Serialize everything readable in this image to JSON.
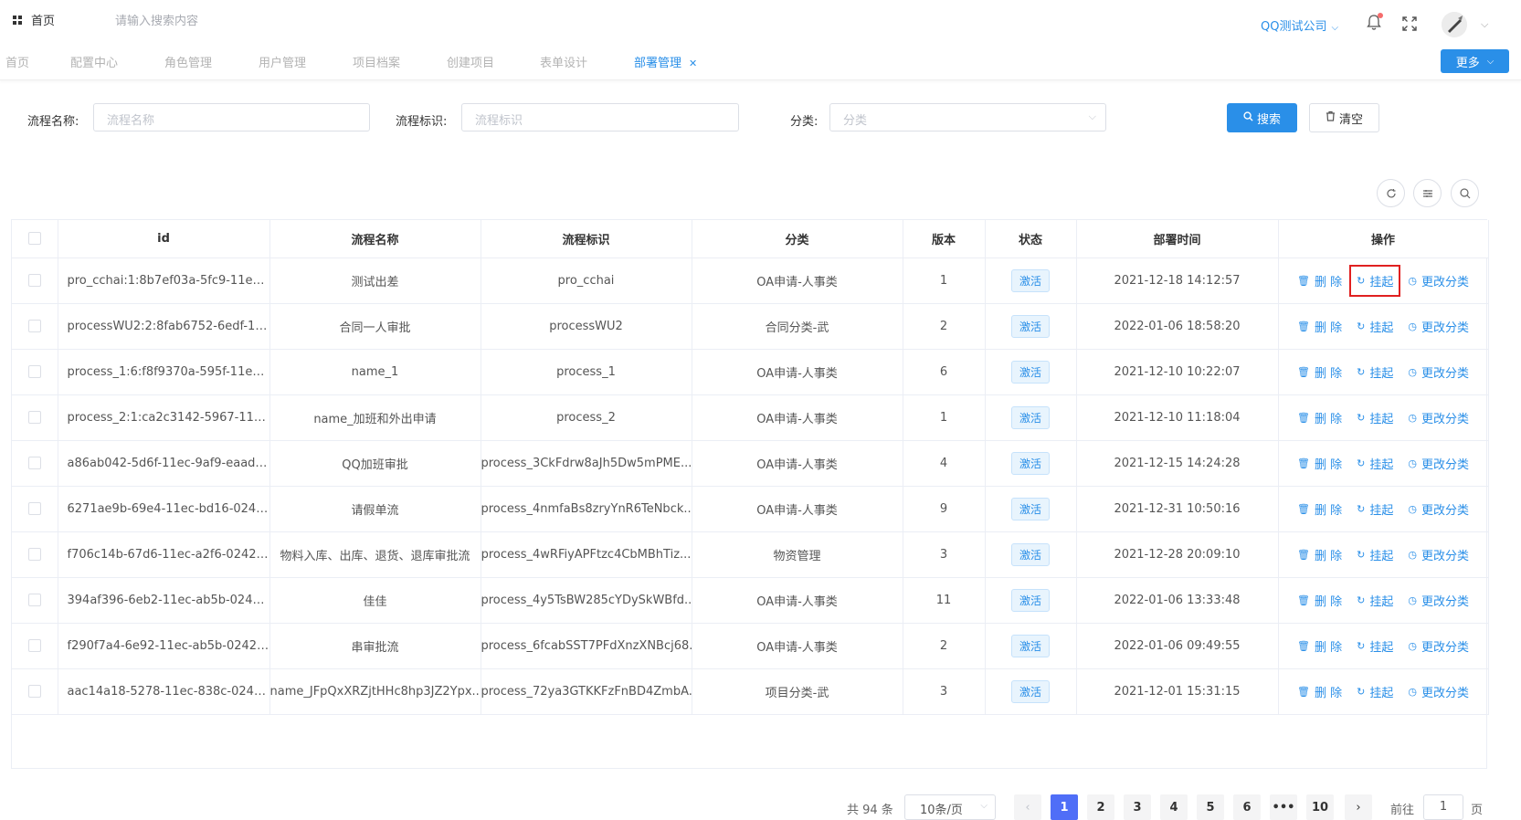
{
  "topbar": {
    "home_label": "首页",
    "search_placeholder": "请输入搜索内容",
    "company": "QQ测试公司"
  },
  "tabs": [
    {
      "label": "首页"
    },
    {
      "label": "配置中心"
    },
    {
      "label": "角色管理"
    },
    {
      "label": "用户管理"
    },
    {
      "label": "项目档案"
    },
    {
      "label": "创建项目"
    },
    {
      "label": "表单设计"
    },
    {
      "label": "部署管理",
      "active": true
    }
  ],
  "more_label": "更多",
  "filters": {
    "name_label": "流程名称:",
    "name_placeholder": "流程名称",
    "key_label": "流程标识:",
    "key_placeholder": "流程标识",
    "category_label": "分类:",
    "category_placeholder": "分类",
    "search_label": "搜索",
    "clear_label": "清空"
  },
  "table": {
    "headers": [
      "id",
      "流程名称",
      "流程标识",
      "分类",
      "版本",
      "状态",
      "部署时间",
      "操作"
    ],
    "op_labels": {
      "delete": "删 除",
      "suspend": "挂起",
      "change": "更改分类"
    },
    "rows": [
      {
        "id": "pro_cchai:1:8b7ef03a-5fc9-11ec-9...",
        "name": "测试出差",
        "key": "pro_cchai",
        "category": "OA申请-人事类",
        "version": "1",
        "status": "激活",
        "time": "2021-12-18 14:12:57"
      },
      {
        "id": "processWU2:2:8fab6752-6edf-11e...",
        "name": "合同一人审批",
        "key": "processWU2",
        "category": "合同分类-武",
        "version": "2",
        "status": "激活",
        "time": "2022-01-06 18:58:20"
      },
      {
        "id": "process_1:6:f8f9370a-595f-11ec-9c...",
        "name": "name_1",
        "key": "process_1",
        "category": "OA申请-人事类",
        "version": "6",
        "status": "激活",
        "time": "2021-12-10 10:22:07"
      },
      {
        "id": "process_2:1:ca2c3142-5967-11ec-...",
        "name": "name_加班和外出申请",
        "key": "process_2",
        "category": "OA申请-人事类",
        "version": "1",
        "status": "激活",
        "time": "2021-12-10 11:18:04"
      },
      {
        "id": "a86ab042-5d6f-11ec-9af9-eaad66...",
        "name": "QQ加班审批",
        "key": "process_3CkFdrw8aJh5Dw5mPME...",
        "category": "OA申请-人事类",
        "version": "4",
        "status": "激活",
        "time": "2021-12-15 14:24:28"
      },
      {
        "id": "6271ae9b-69e4-11ec-bd16-0242a...",
        "name": "请假单流",
        "key": "process_4nmfaBs8zryYnR6TeNbck...",
        "category": "OA申请-人事类",
        "version": "9",
        "status": "激活",
        "time": "2021-12-31 10:50:16"
      },
      {
        "id": "f706c14b-67d6-11ec-a2f6-0242ac...",
        "name": "物料入库、出库、退货、退库审批流",
        "key": "process_4wRFiyAPFtzc4CbMBhTiz...",
        "category": "物资管理",
        "version": "3",
        "status": "激活",
        "time": "2021-12-28 20:09:10"
      },
      {
        "id": "394af396-6eb2-11ec-ab5b-0242ac...",
        "name": "佳佳",
        "key": "process_4y5TsBW285cYDySkWBfd...",
        "category": "OA申请-人事类",
        "version": "11",
        "status": "激活",
        "time": "2022-01-06 13:33:48"
      },
      {
        "id": "f290f7a4-6e92-11ec-ab5b-0242ac...",
        "name": "串审批流",
        "key": "process_6fcabSST7PFdXnzXNBcj68...",
        "category": "OA申请-人事类",
        "version": "2",
        "status": "激活",
        "time": "2022-01-06 09:49:55"
      },
      {
        "id": "aac14a18-5278-11ec-838c-0242ac...",
        "name": "name_JFpQxXRZjtHHc8hp3JZ2Ypx...",
        "key": "process_72ya3GTKKFzFnBD4ZmbA...",
        "category": "项目分类-武",
        "version": "3",
        "status": "激活",
        "time": "2021-12-01 15:31:15"
      }
    ]
  },
  "pagination": {
    "total_text": "共 94 条",
    "page_size": "10条/页",
    "pages": [
      "1",
      "2",
      "3",
      "4",
      "5",
      "6",
      "•••",
      "10"
    ],
    "current": "1",
    "goto_label": "前往",
    "goto_value": "1",
    "page_unit": "页"
  },
  "colors": {
    "accent": "#2a8fe8",
    "active_page": "#4f6ef7",
    "highlight_box": "#e02020"
  }
}
